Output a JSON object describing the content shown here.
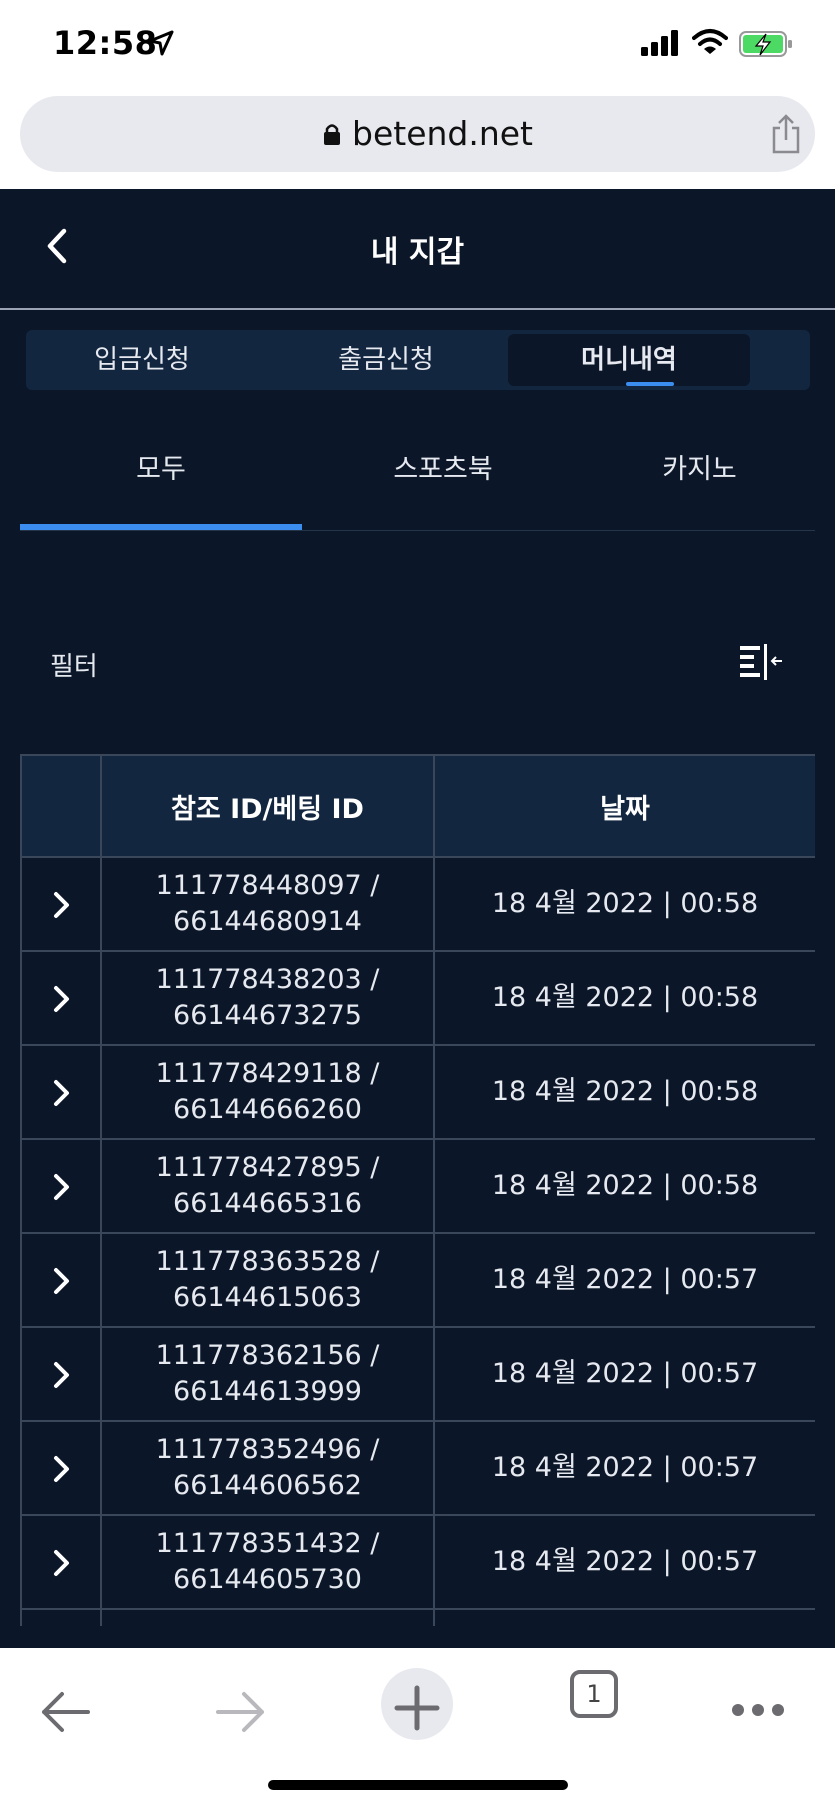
{
  "status_bar": {
    "time": "12:58"
  },
  "browser": {
    "url": "betend.net",
    "tab_count": "1"
  },
  "header": {
    "title": "내 지갑"
  },
  "segment_tabs": [
    {
      "label": "입금신청",
      "active": false
    },
    {
      "label": "출금신청",
      "active": false
    },
    {
      "label": "머니내역",
      "active": true
    }
  ],
  "category_tabs": [
    {
      "label": "모두",
      "active": true
    },
    {
      "label": "스포츠북",
      "active": false
    },
    {
      "label": "카지노",
      "active": false
    }
  ],
  "filter": {
    "label": "필터"
  },
  "table": {
    "headers": [
      "",
      "참조 ID/베팅 ID",
      "날짜"
    ],
    "rows": [
      {
        "id": "111778448097 /",
        "bet": "66144680914",
        "date": "18 4월 2022 | 00:58"
      },
      {
        "id": "111778438203 /",
        "bet": "66144673275",
        "date": "18 4월 2022 | 00:58"
      },
      {
        "id": "111778429118 /",
        "bet": "66144666260",
        "date": "18 4월 2022 | 00:58"
      },
      {
        "id": "111778427895 /",
        "bet": "66144665316",
        "date": "18 4월 2022 | 00:58"
      },
      {
        "id": "111778363528 /",
        "bet": "66144615063",
        "date": "18 4월 2022 | 00:57"
      },
      {
        "id": "111778362156 /",
        "bet": "66144613999",
        "date": "18 4월 2022 | 00:57"
      },
      {
        "id": "111778352496 /",
        "bet": "66144606562",
        "date": "18 4월 2022 | 00:57"
      },
      {
        "id": "111778351432 /",
        "bet": "66144605730",
        "date": "18 4월 2022 | 00:57"
      }
    ]
  },
  "colors": {
    "background": "#0b1628",
    "accent": "#3b8ef0",
    "panel": "#13263f"
  }
}
